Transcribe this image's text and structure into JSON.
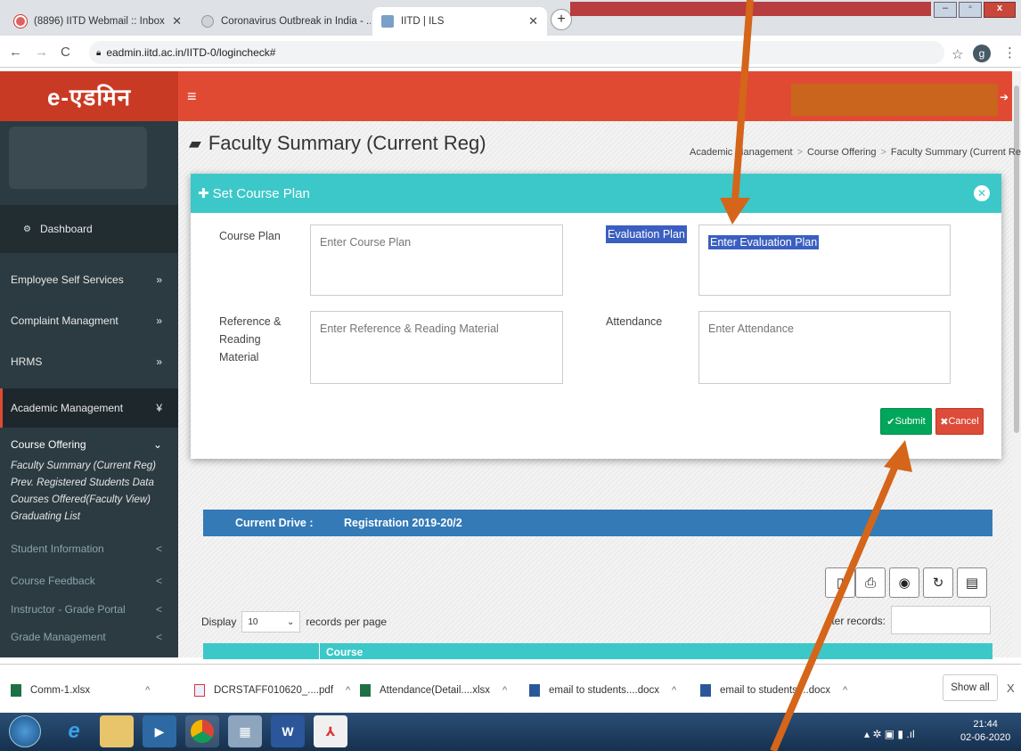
{
  "browser": {
    "tabs": [
      {
        "title": "(8896) IITD Webmail :: Inbox",
        "icon": "webmail-icon"
      },
      {
        "title": "Coronavirus Outbreak in India - ...",
        "icon": "globe-icon"
      },
      {
        "title": "IITD | ILS",
        "icon": "ils-icon"
      }
    ],
    "new_tab": "+",
    "url": "eadmin.iitd.ac.in/IITD-0/logincheck#",
    "profile_initial": "g"
  },
  "app": {
    "logo": "e-एडमिन",
    "menu_icon": "≡"
  },
  "sidebar": {
    "dashboard": "Dashboard",
    "items": [
      {
        "label": "Employee Self Services",
        "chev": "»"
      },
      {
        "label": "Complaint Managment",
        "chev": "»"
      },
      {
        "label": "HRMS",
        "chev": "»"
      },
      {
        "label": "Academic Management",
        "chev": "¥"
      }
    ],
    "course_offering": {
      "label": "Course Offering",
      "chev": "⌄"
    },
    "sub_items": [
      "Faculty Summary (Current Reg)",
      "Prev. Registered Students Data",
      "Courses Offered(Faculty View)",
      "Graduating List"
    ],
    "groups": [
      {
        "label": "Student Information",
        "chev": "<"
      },
      {
        "label": "Course Feedback",
        "chev": "<"
      },
      {
        "label": "Instructor - Grade Portal",
        "chev": "<"
      },
      {
        "label": "Grade Management",
        "chev": "<"
      }
    ]
  },
  "page": {
    "title": "Faculty Summary (Current Reg)",
    "breadcrumb": [
      "Academic Management",
      "Course Offering",
      "Faculty Summary (Current Reg)"
    ]
  },
  "modal": {
    "title": "Set Course Plan",
    "fields": {
      "course_plan": {
        "label": "Course Plan",
        "placeholder": "Enter Course Plan"
      },
      "evaluation_plan": {
        "label": "Evaluation Plan",
        "placeholder": "Enter Evaluation Plan"
      },
      "reference": {
        "label": "Reference & Reading Material",
        "placeholder": "Enter Reference & Reading Material"
      },
      "attendance": {
        "label": "Attendance",
        "placeholder": "Enter Attendance"
      }
    },
    "submit": "Submit",
    "cancel": "Cancel"
  },
  "drive": {
    "label": "Current Drive :",
    "value": "Registration 2019-20/2"
  },
  "table_controls": {
    "display": "Display",
    "records_value": "10",
    "records_per_page": "records per page",
    "filter": "ilter records:",
    "header_course": "Course"
  },
  "downloads": {
    "items": [
      "Comm-1.xlsx",
      "DCRSTAFF010620_....pdf",
      "Attendance(Detail....xlsx",
      "email to students....docx",
      "email to students....docx"
    ],
    "show_all": "Show all",
    "close": "X"
  },
  "taskbar": {
    "time": "21:44",
    "date": "02-06-2020"
  },
  "colors": {
    "header_red": "#e04a33",
    "sidebar": "#2c3b41",
    "teal": "#3cc8c8",
    "submit_green": "#00a65a",
    "cancel_red": "#dd4b39",
    "drive_blue": "#337ab7",
    "annotation_arrow": "#d5651a"
  }
}
